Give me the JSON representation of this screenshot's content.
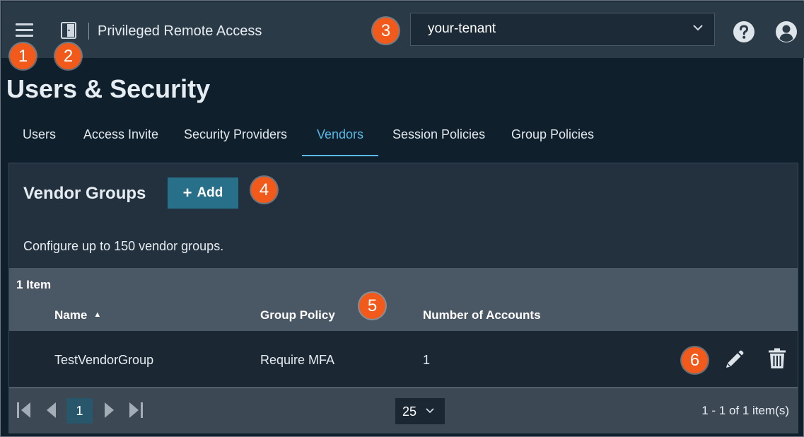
{
  "header": {
    "app_title": "Privileged Remote Access",
    "tenant": "your-tenant"
  },
  "icons": {
    "menu": "hamburger-menu-icon",
    "app": "door-icon",
    "tenant_dropdown": "chevron-down-icon",
    "help": "help-circle-icon",
    "account": "user-circle-icon",
    "sort": "sort-ascending-icon",
    "edit": "pencil-icon",
    "delete": "trash-icon",
    "first": "first-page-icon",
    "prev": "prev-page-icon",
    "next": "next-page-icon",
    "last": "last-page-icon"
  },
  "callouts": [
    "1",
    "2",
    "3",
    "4",
    "5",
    "6"
  ],
  "page": {
    "title": "Users & Security"
  },
  "tabs": [
    {
      "label": "Users",
      "active": false
    },
    {
      "label": "Access Invite",
      "active": false
    },
    {
      "label": "Security Providers",
      "active": false
    },
    {
      "label": "Vendors",
      "active": true
    },
    {
      "label": "Session Policies",
      "active": false
    },
    {
      "label": "Group Policies",
      "active": false
    }
  ],
  "panel": {
    "title": "Vendor Groups",
    "add_label": "Add",
    "description": "Configure up to 150 vendor groups."
  },
  "table": {
    "item_count": "1 Item",
    "columns": [
      "Name",
      "Group Policy",
      "Number of Accounts"
    ],
    "rows": [
      {
        "name": "TestVendorGroup",
        "policy": "Require MFA",
        "accounts": "1"
      }
    ]
  },
  "pager": {
    "current_page": "1",
    "page_size": "25",
    "range": "1 - 1 of 1 item(s)"
  },
  "colors": {
    "accent": "#5ab9e8",
    "callout": "#f25a1b",
    "button": "#28708a"
  }
}
